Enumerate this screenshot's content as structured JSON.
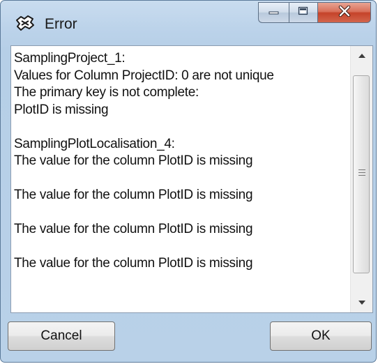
{
  "window": {
    "title": "Error",
    "icon": "error-app-icon"
  },
  "caption_buttons": {
    "minimize_icon": "minimize-icon",
    "maximize_icon": "maximize-icon",
    "close_icon": "close-icon"
  },
  "message": {
    "lines": [
      "SamplingProject_1:",
      "Values for  Column ProjectID: 0 are not unique",
      "The primary key is not complete:",
      "PlotID is missing",
      "",
      "SamplingPlotLocalisation_4:",
      "The value for the column PlotID is missing",
      "",
      "The value for the column PlotID is missing",
      "",
      "The value for the column PlotID is missing",
      "",
      "The value for the column PlotID is missing"
    ],
    "text": "SamplingProject_1:\nValues for  Column ProjectID: 0 are not unique\nThe primary key is not complete:\nPlotID is missing\n\nSamplingPlotLocalisation_4:\nThe value for the column PlotID is missing\n\nThe value for the column PlotID is missing\n\nThe value for the column PlotID is missing\n\nThe value for the column PlotID is missing"
  },
  "buttons": {
    "cancel_label": "Cancel",
    "ok_label": "OK"
  },
  "colors": {
    "titlebar": "#bcd3ea",
    "close_button": "#c5432a"
  }
}
